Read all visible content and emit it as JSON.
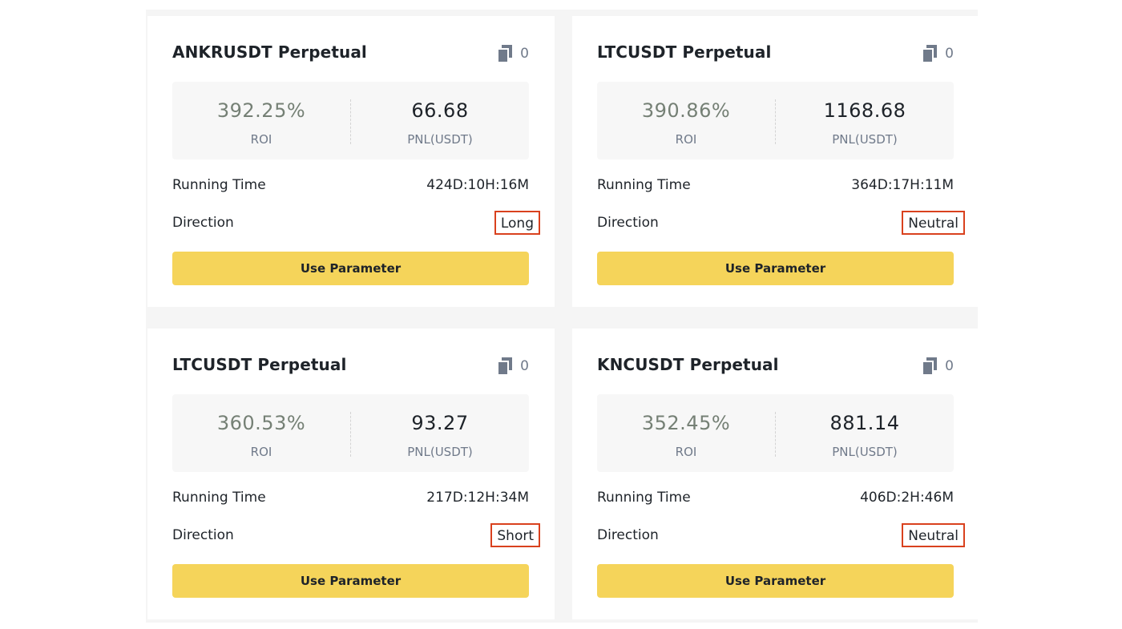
{
  "copy_icon": "copy-icon",
  "colors": {
    "button_bg": "#f5d45a",
    "roi_text": "#758075",
    "highlight_border": "#d9411e"
  },
  "cards": [
    {
      "title": "ANKRUSDT Perpetual",
      "copy_count": "0",
      "roi_value": "392.25%",
      "roi_label": "ROI",
      "pnl_value": "66.68",
      "pnl_label": "PNL(USDT)",
      "running_time_label": "Running Time",
      "running_time_value": "424D:10H:16M",
      "direction_label": "Direction",
      "direction_value": "Long",
      "button_label": "Use Parameter"
    },
    {
      "title": "LTCUSDT Perpetual",
      "copy_count": "0",
      "roi_value": "390.86%",
      "roi_label": "ROI",
      "pnl_value": "1168.68",
      "pnl_label": "PNL(USDT)",
      "running_time_label": "Running Time",
      "running_time_value": "364D:17H:11M",
      "direction_label": "Direction",
      "direction_value": "Neutral",
      "button_label": "Use Parameter"
    },
    {
      "title": "LTCUSDT Perpetual",
      "copy_count": "0",
      "roi_value": "360.53%",
      "roi_label": "ROI",
      "pnl_value": "93.27",
      "pnl_label": "PNL(USDT)",
      "running_time_label": "Running Time",
      "running_time_value": "217D:12H:34M",
      "direction_label": "Direction",
      "direction_value": "Short",
      "button_label": "Use Parameter"
    },
    {
      "title": "KNCUSDT Perpetual",
      "copy_count": "0",
      "roi_value": "352.45%",
      "roi_label": "ROI",
      "pnl_value": "881.14",
      "pnl_label": "PNL(USDT)",
      "running_time_label": "Running Time",
      "running_time_value": "406D:2H:46M",
      "direction_label": "Direction",
      "direction_value": "Neutral",
      "button_label": "Use Parameter"
    }
  ]
}
